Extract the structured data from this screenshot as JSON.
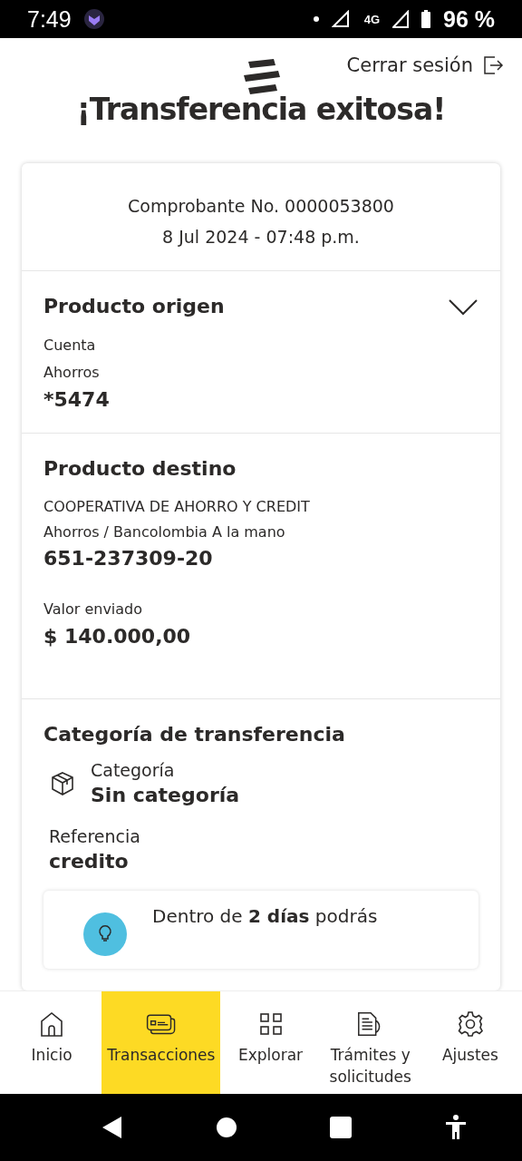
{
  "status_bar": {
    "time": "7:49",
    "network": "4G",
    "battery": "96 %"
  },
  "header": {
    "logout": "Cerrar sesión"
  },
  "title": "¡Transferencia exitosa!",
  "receipt": {
    "number": "Comprobante No. 0000053800",
    "date": "8 Jul 2024 - 07:48 p.m."
  },
  "origin": {
    "heading": "Producto origen",
    "expanded": false,
    "lines": [
      "Cuenta",
      "Ahorros"
    ],
    "account": "*5474"
  },
  "destination": {
    "heading": "Producto destino",
    "name": "COOPERATIVA DE AHORRO Y CREDIT",
    "type": "Ahorros / Bancolombia A la mano",
    "account": "651-237309-20",
    "amount_label": "Valor enviado",
    "amount": "$ 140.000,00"
  },
  "category": {
    "heading": "Categoría de transferencia",
    "label": "Categoría",
    "value": "Sin categoría",
    "ref_label": "Referencia",
    "ref_value": "credito",
    "tip": "Dentro de **2 días** podrás"
  },
  "nav": [
    {
      "kind": "home",
      "label": "Inicio",
      "selected": false
    },
    {
      "kind": "cards",
      "label": "Transacciones",
      "selected": true
    },
    {
      "kind": "grid",
      "label": "Explorar",
      "selected": false
    },
    {
      "kind": "docs",
      "label": "Trámites y solicitudes",
      "selected": false
    },
    {
      "kind": "gear",
      "label": "Ajustes",
      "selected": false
    }
  ]
}
